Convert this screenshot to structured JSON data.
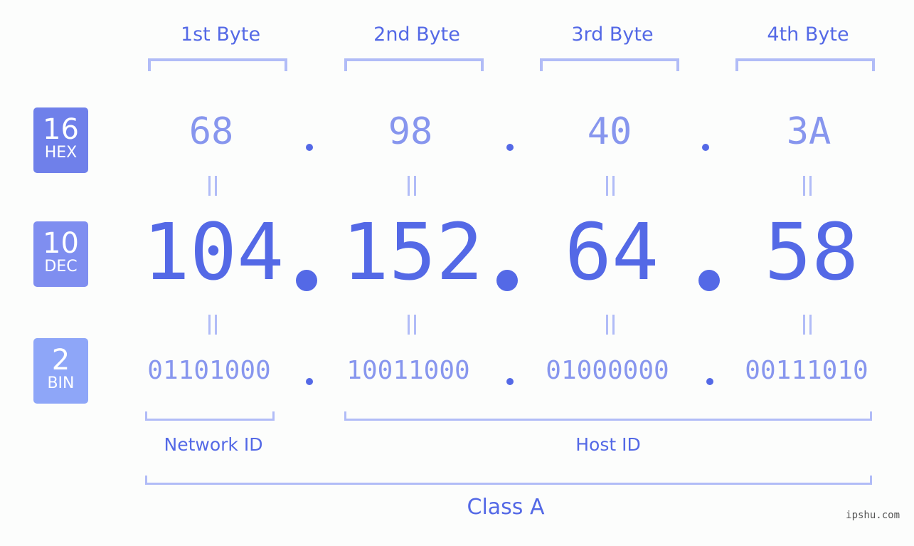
{
  "ip": {
    "hex": [
      "68",
      "98",
      "40",
      "3A"
    ],
    "dec": [
      "104",
      "152",
      "64",
      "58"
    ],
    "bin": [
      "01101000",
      "10011000",
      "01000000",
      "00111010"
    ],
    "separator": "."
  },
  "byte_labels": [
    "1st Byte",
    "2nd Byte",
    "3rd Byte",
    "4th Byte"
  ],
  "badges": {
    "hex": {
      "num": "16",
      "label": "HEX",
      "color": "#6f80ea"
    },
    "dec": {
      "num": "10",
      "label": "DEC",
      "color": "#7f8ef0"
    },
    "bin": {
      "num": "2",
      "label": "BIN",
      "color": "#8ea6f8"
    }
  },
  "segments": {
    "network_id": "Network ID",
    "host_id": "Host ID",
    "class": "Class A"
  },
  "watermark": "ipshu.com",
  "colors": {
    "accent": "#5469e6",
    "light": "#8796ee",
    "bracket": "#b1bcf7"
  }
}
